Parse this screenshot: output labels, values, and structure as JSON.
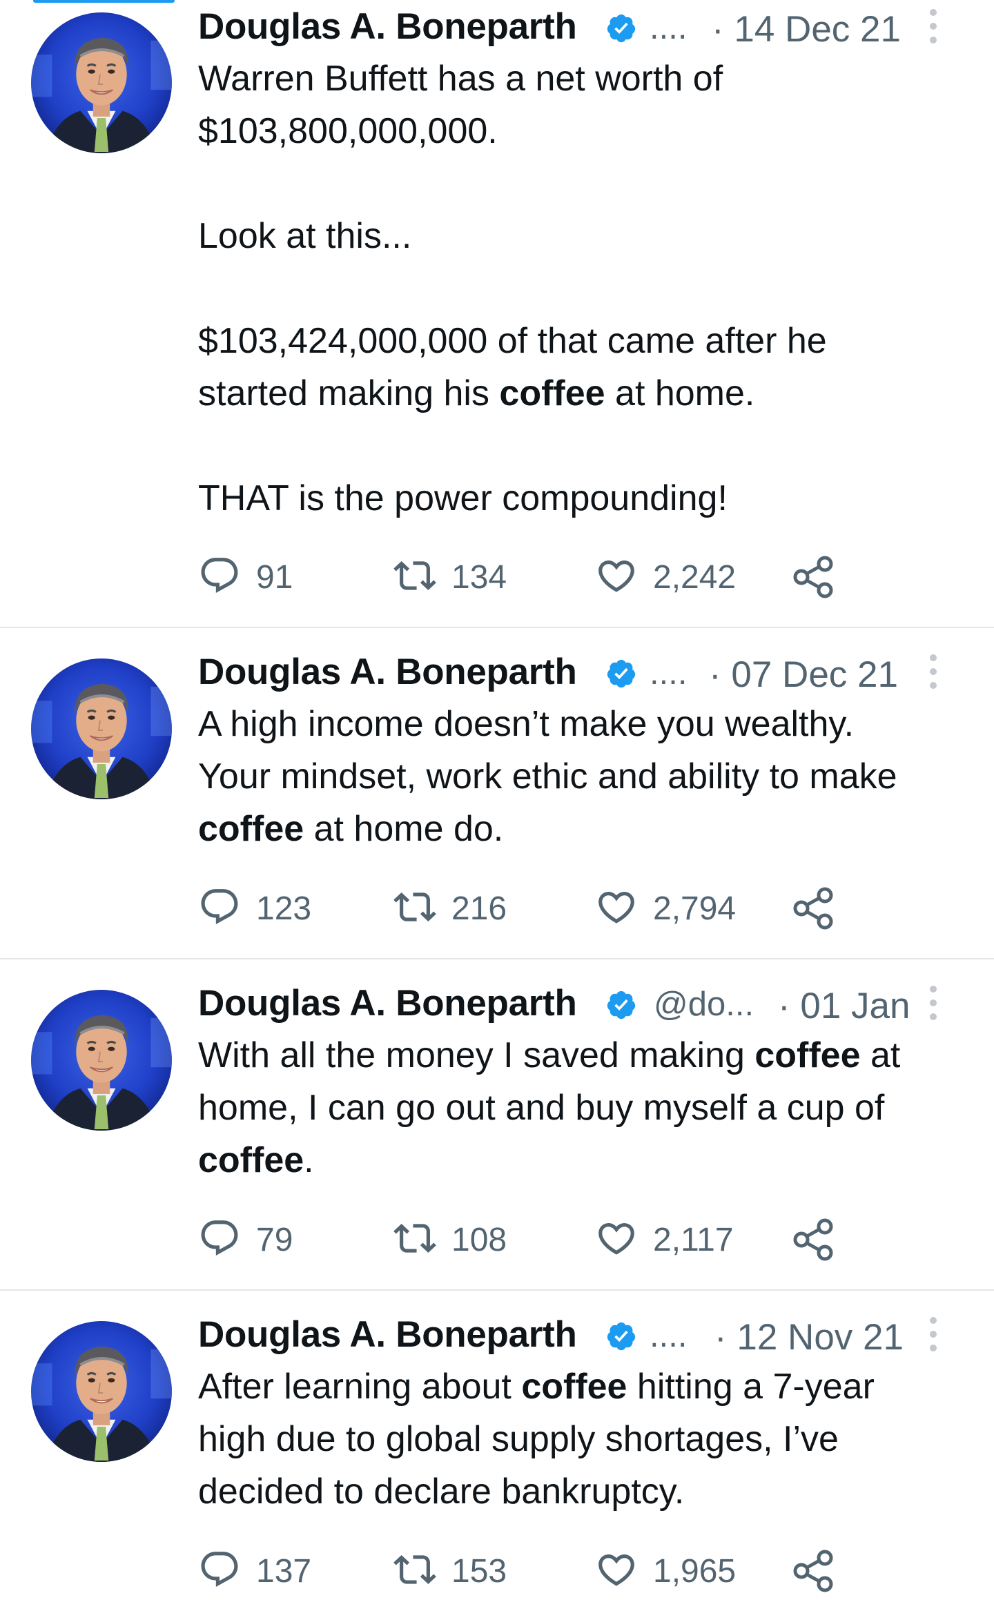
{
  "tweets": [
    {
      "author": "Douglas A. Boneparth",
      "handle": "....",
      "date": "· 14 Dec 21",
      "text": [
        {
          "t": "Warren Buffett has a net worth of\n$103,800,000,000.\n\nLook at this...\n\n$103,424,000,000 of that came after he\nstarted making his "
        },
        {
          "t": "coffee",
          "b": true
        },
        {
          "t": " at home.\n\nTHAT is the power compounding!"
        }
      ],
      "replies": "91",
      "retweets": "134",
      "likes": "2,242"
    },
    {
      "author": "Douglas A. Boneparth",
      "handle": "....",
      "date": "· 07 Dec 21",
      "text": [
        {
          "t": "A high income doesn’t make you wealthy.\nYour mindset, work ethic and ability to make\n"
        },
        {
          "t": "coffee",
          "b": true
        },
        {
          "t": " at home do."
        }
      ],
      "replies": "123",
      "retweets": "216",
      "likes": "2,794"
    },
    {
      "author": "Douglas A. Boneparth",
      "handle": "@do...",
      "date": "· 01 Jan",
      "text": [
        {
          "t": "With all the money I saved making "
        },
        {
          "t": "coffee",
          "b": true
        },
        {
          "t": " at\nhome, I can go out and buy myself a cup of\n"
        },
        {
          "t": "coffee",
          "b": true
        },
        {
          "t": "."
        }
      ],
      "replies": "79",
      "retweets": "108",
      "likes": "2,117"
    },
    {
      "author": "Douglas A. Boneparth",
      "handle": "....",
      "date": "· 12 Nov 21",
      "text": [
        {
          "t": "After learning about "
        },
        {
          "t": "coffee",
          "b": true
        },
        {
          "t": " hitting a 7-year\nhigh due to global supply shortages, I’ve\ndecided to declare bankruptcy."
        }
      ],
      "replies": "137",
      "retweets": "153",
      "likes": "1,965"
    }
  ],
  "colors": {
    "accent": "#1d9bf0",
    "text": "#0f1419",
    "muted": "#536471",
    "divider": "#e6e6e6"
  },
  "icons": [
    "avatar-photo",
    "verified-badge-icon",
    "more-options-icon",
    "reply-icon",
    "retweet-icon",
    "like-icon",
    "share-icon"
  ]
}
